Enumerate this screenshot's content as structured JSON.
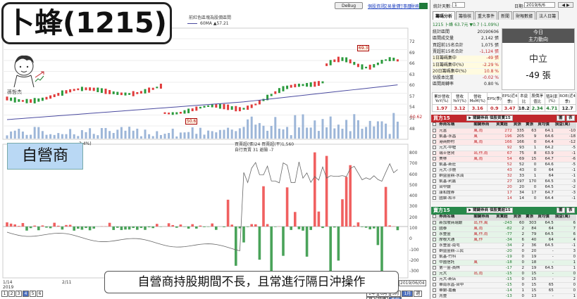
{
  "title_overlay": {
    "text": "卜蜂(1215)"
  },
  "avatar": {
    "caption": "孫哲杰"
  },
  "segment_label": "自營商",
  "bottom_caption": "自營商持股期間不長，且常進行隔日沖操作",
  "top_bar": {
    "debug": "DeBug",
    "links": [
      "個股資訊",
      "交易量價",
      "行事曆",
      "財務報表"
    ]
  },
  "chart": {
    "title": "前紅色區塊為股價區間",
    "ma_legend": "60MA ▲57.21",
    "price_ticks": [
      "72",
      "69",
      "66",
      "63",
      "60",
      "57",
      "54",
      "51",
      "48"
    ],
    "high_flag": "69.3",
    "low_flag": "50.6",
    "current_price_label": "50.62",
    "sub_legend": "買賣超(張)24 買賣超(平)1,560",
    "sub_legend2": "自行買賣 31 避險 -7",
    "left_legend": "3.4%)",
    "sub_ticks": [
      "800",
      "700",
      "600",
      "500",
      "400",
      "300",
      "200",
      "100",
      "0",
      "-100",
      "-200",
      "-300"
    ],
    "dates": [
      "1/14",
      "2019",
      "2/11",
      "2019/06/04"
    ],
    "pager": [
      "1",
      "2",
      "3",
      "4",
      "5",
      "6"
    ],
    "pager_active": "4",
    "periods": [
      "1年",
      "6月",
      "3月",
      "1月",
      "週",
      "月",
      "除權",
      "季線"
    ]
  },
  "right": {
    "stats_label": "統計天數:",
    "stats_value": "1",
    "date_label": "日期:",
    "date_value": "2019/6/6",
    "tabs": [
      "籌碼分析",
      "籌檢核",
      "重大事件",
      "新聞",
      "財報數據",
      "法人日籌"
    ],
    "stock_line": "1215  卜蜂   63.7元 ▼0.7 (-1.09%)",
    "kv": [
      {
        "k": "統計區間",
        "v": "20190606"
      },
      {
        "k": "區間成交量",
        "v": "2,142 張"
      },
      {
        "k": "買超前15名合計",
        "v": "1,075 張"
      },
      {
        "k": "賣超前15名合計",
        "v": "-1,124 張"
      },
      {
        "k": "1日籌碼集中",
        "v": "-49 張"
      },
      {
        "k": "1日籌碼集中(%)",
        "v": "-2.29 %"
      },
      {
        "k": "20日籌碼集中(%)",
        "v": "10.8 %"
      },
      {
        "k": "佔股本比重",
        "v": "-0.02 %"
      },
      {
        "k": "區間周轉率",
        "v": "0.80 %"
      }
    ],
    "today": {
      "head1": "今日",
      "head2": "主力動向",
      "status": "中立",
      "value": "-49 張"
    },
    "metrics_head": [
      "累計營收YoY(%)",
      "營收YoY(%)",
      "營收MoM(%)",
      "EPS(季)",
      "EPS(近4季)",
      "本益比",
      "股價淨值比",
      "殖利率(%)",
      "ROE(近4季)"
    ],
    "metrics_val": [
      "1.97",
      "3.12",
      "3.16",
      "0.9",
      "3.47",
      "18.2",
      "2.34",
      "4.71",
      "12.7"
    ],
    "buy": {
      "title": "買方15",
      "ctrl": "▶ 關鍵券商  個股買賣15",
      "headers": [
        "券商名稱",
        "關鍵券商",
        "買賣超",
        "買張",
        "賣張",
        "買均價",
        "損益(萬)"
      ],
      "rows": [
        [
          "元富",
          "風,雨",
          "272",
          "335",
          "63",
          "64.1",
          "-10"
        ],
        [
          "凱基-永昌",
          "風",
          "196",
          "205",
          "9",
          "64.6",
          "-18"
        ],
        [
          "港商野村",
          "風,雨",
          "166",
          "166",
          "0",
          "64.4",
          "-12"
        ],
        [
          "元大-中壢",
          "",
          "92",
          "93",
          "1",
          "64.2",
          "-5"
        ],
        [
          "瑞士信貸",
          "出,作,雨",
          "67",
          "75",
          "8",
          "63.9",
          "-1"
        ],
        [
          "美林",
          "風,雨",
          "54",
          "69",
          "15",
          "64.7",
          "-6"
        ],
        [
          "凱基-新莊",
          "",
          "52",
          "52",
          "0",
          "64.6",
          "-5"
        ],
        [
          "元大-沙鹿",
          "",
          "43",
          "43",
          "0",
          "64",
          "-1"
        ],
        [
          "群益金鼎-水湳",
          "",
          "32",
          "33",
          "1",
          "64",
          "-1"
        ],
        [
          "凱基-利鑫",
          "",
          "27",
          "197",
          "170",
          "64.5",
          "-3"
        ],
        [
          "台中銀",
          "",
          "20",
          "20",
          "0",
          "64.5",
          "-2"
        ],
        [
          "康和證券",
          "",
          "17",
          "34",
          "17",
          "64.7",
          "-3"
        ],
        [
          "國票-和平",
          "",
          "14",
          "14",
          "0",
          "64.4",
          "-1"
        ]
      ]
    },
    "sell": {
      "title": "賣方15",
      "ctrl": "▶ 關鍵券商  個股賣超15",
      "headers": [
        "券商名稱",
        "關鍵券商",
        "買賣超",
        "買張",
        "賣張",
        "買均價",
        "損益(萬)"
      ],
      "rows": [
        [
          "新加坡商瑞銀",
          "出,作,風",
          "-243",
          "60",
          "303",
          "64.5",
          "6"
        ],
        [
          "國泰",
          "風,雨",
          "-82",
          "2",
          "84",
          "64",
          "7"
        ],
        [
          "永豐金",
          "風,作,雨",
          "-77",
          "2",
          "79",
          "64.5",
          "6"
        ],
        [
          "摩根大通",
          "風,作",
          "-34",
          "6",
          "40",
          "64",
          "4"
        ],
        [
          "永豐金-南屯",
          "",
          "-34",
          "2",
          "36",
          "64.5",
          "-1"
        ],
        [
          "群益金鼎-三民",
          "",
          "-20",
          "0",
          "20",
          "-",
          "3"
        ],
        [
          "凱基-竹科",
          "",
          "-19",
          "0",
          "19",
          "-",
          "0"
        ],
        [
          "中國信託",
          "風",
          "-18",
          "0",
          "18",
          "-",
          "1"
        ],
        [
          "第一金-員林",
          "",
          "-17",
          "2",
          "19",
          "64.5",
          "1"
        ],
        [
          "元大",
          "出,雨",
          "-15",
          "0",
          "15",
          "-",
          "0"
        ],
        [
          "元大-新店",
          "",
          "-15",
          "0",
          "15",
          "-",
          "2"
        ],
        [
          "華南永昌-台中",
          "",
          "-15",
          "0",
          "15",
          "65",
          "0"
        ],
        [
          "華銀-嘉義",
          "",
          "-14",
          "1",
          "15",
          "65",
          "0"
        ],
        [
          "兆豐",
          "",
          "-13",
          "0",
          "13",
          "-",
          "1"
        ]
      ]
    }
  }
}
